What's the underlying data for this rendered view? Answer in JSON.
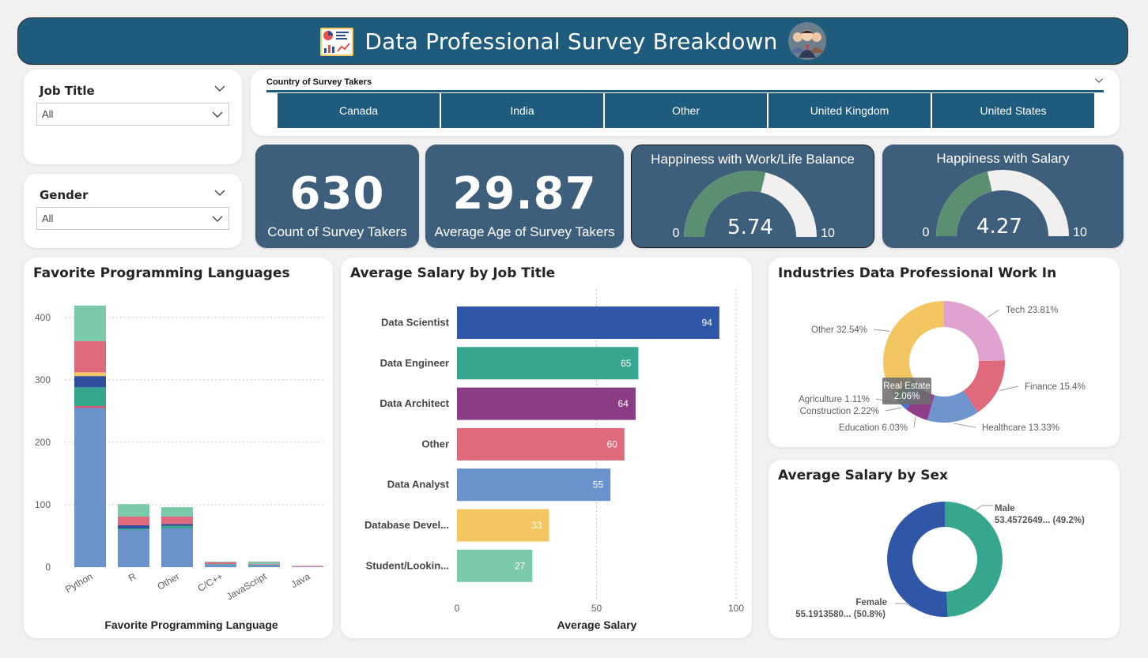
{
  "header": {
    "title": "Data Professional Survey Breakdown"
  },
  "slicers": {
    "job_title": {
      "label": "Job Title",
      "value": "All"
    },
    "gender": {
      "label": "Gender",
      "value": "All"
    }
  },
  "country": {
    "title": "Country of Survey Takers",
    "options": [
      "Canada",
      "India",
      "Other",
      "United Kingdom",
      "United States"
    ]
  },
  "kpis": {
    "count": {
      "value": "630",
      "label": "Count of Survey Takers"
    },
    "age": {
      "value": "29.87",
      "label": "Average Age of Survey Takers"
    }
  },
  "gauges": {
    "worklife": {
      "title": "Happiness with Work/Life Balance",
      "value": 5.74,
      "value_label": "5.74",
      "min_label": "0",
      "max_label": "10"
    },
    "salary": {
      "title": "Happiness with Salary",
      "value": 4.27,
      "value_label": "4.27",
      "min_label": "0",
      "max_label": "10"
    }
  },
  "colors": {
    "header": "#1e5b7c",
    "kpi": "#3e5f7b",
    "gauge_fill": "#5b8f72",
    "gauge_track": "#f2f0ee"
  },
  "chart_data": [
    {
      "id": "languages",
      "type": "bar",
      "title": "Favorite Programming Languages",
      "xlabel": "Favorite Programming Language",
      "ylabel": "",
      "ylim": [
        0,
        420
      ],
      "yticks": [
        "0",
        "100",
        "200",
        "300",
        "400"
      ],
      "categories": [
        "Python",
        "R",
        "Other",
        "C/C++",
        "JavaScript",
        "Java"
      ],
      "stacked": true,
      "grid": true,
      "series": [
        {
          "color": "#6b93cb",
          "values": [
            255,
            60,
            62,
            4,
            3,
            1
          ]
        },
        {
          "color": "#d9506a",
          "values": [
            3,
            0,
            0,
            0,
            0,
            0
          ]
        },
        {
          "color": "#34a68e",
          "values": [
            30,
            2,
            4,
            1,
            1,
            0
          ]
        },
        {
          "color": "#2f4f9e",
          "values": [
            18,
            5,
            3,
            0,
            0,
            0
          ]
        },
        {
          "color": "#f4c662",
          "values": [
            6,
            0,
            0,
            0,
            0,
            0
          ]
        },
        {
          "color": "#e06a7d",
          "values": [
            50,
            14,
            12,
            3,
            1,
            1
          ]
        },
        {
          "color": "#7ac9aa",
          "values": [
            57,
            20,
            15,
            1,
            3,
            0
          ]
        },
        {
          "color": "#9e9e9e",
          "values": [
            0,
            0,
            0,
            0,
            1,
            0
          ]
        }
      ]
    },
    {
      "id": "salary_job",
      "type": "bar",
      "orientation": "horizontal",
      "title": "Average Salary by Job Title",
      "xlabel": "Average Salary",
      "ylabel": "",
      "xlim": [
        0,
        100
      ],
      "xticks": [
        "0",
        "50",
        "100"
      ],
      "grid": true,
      "categories": [
        "Data Scientist",
        "Data Engineer",
        "Data Architect",
        "Other",
        "Data Analyst",
        "Database Devel...",
        "Student/Lookin..."
      ],
      "values": [
        94,
        65,
        64,
        60,
        55,
        33,
        27
      ],
      "value_labels": [
        "94",
        "65",
        "64",
        "60",
        "55",
        "33",
        "27"
      ],
      "colors": [
        "#3056a8",
        "#36a68e",
        "#8a3c85",
        "#de6a7b",
        "#6b93cb",
        "#f4c662",
        "#7ac9aa"
      ]
    },
    {
      "id": "industries",
      "type": "pie",
      "donut": true,
      "title": "Industries Data Professional Work In",
      "slices": [
        {
          "label": "Tech 23.81%",
          "value": 23.81,
          "color": "#e0a2ce"
        },
        {
          "label": "Finance 15.4%",
          "value": 15.4,
          "color": "#df6a7b"
        },
        {
          "label": "Healthcare 13.33%",
          "value": 13.33,
          "color": "#6d94cc"
        },
        {
          "label": "Education 6.03%",
          "value": 6.03,
          "color": "#8e3d86"
        },
        {
          "label": "Construction 2.22%",
          "value": 2.22,
          "color": "#4b74d8"
        },
        {
          "label": "Agriculture 1.11%",
          "value": 1.11,
          "color": "#2e8a73"
        },
        {
          "label": "Real Estate 2.06%",
          "value": 2.06,
          "color": "#3a8f5a"
        },
        {
          "label": "Other 32.54%",
          "value": 32.54,
          "color": "#f4c662"
        }
      ],
      "tooltip": {
        "line1": "Real Estate",
        "line2": "2.06%"
      }
    },
    {
      "id": "salary_sex",
      "type": "pie",
      "donut": true,
      "title": "Average Salary by Sex",
      "slices": [
        {
          "name": "Male",
          "label": "53.4572649... (49.2%)",
          "value": 49.2,
          "color": "#36a68e"
        },
        {
          "name": "Female",
          "label": "55.1913580... (50.8%)",
          "value": 50.8,
          "color": "#3056a8"
        }
      ]
    }
  ]
}
